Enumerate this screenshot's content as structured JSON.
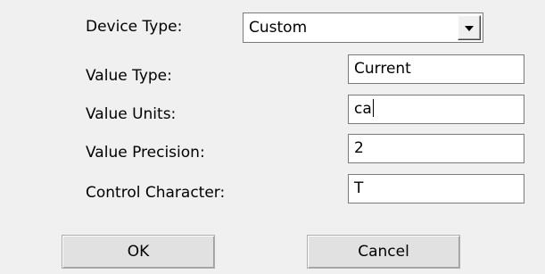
{
  "device_type": {
    "label": "Device Type:",
    "selected": "Custom"
  },
  "fields": {
    "value_type": {
      "label": "Value Type:",
      "value": "Current"
    },
    "value_units": {
      "label": "Value Units:",
      "value": "ca"
    },
    "value_precision": {
      "label": "Value Precision:",
      "value": "2"
    },
    "control_character": {
      "label": "Control Character:",
      "value": "T"
    }
  },
  "buttons": {
    "ok": "OK",
    "cancel": "Cancel"
  },
  "icons": {
    "dropdown": "chevron-down-icon"
  },
  "colors": {
    "background": "#f0f0f0",
    "field_border": "#7a7a7a",
    "button_face": "#e1e1e1"
  }
}
